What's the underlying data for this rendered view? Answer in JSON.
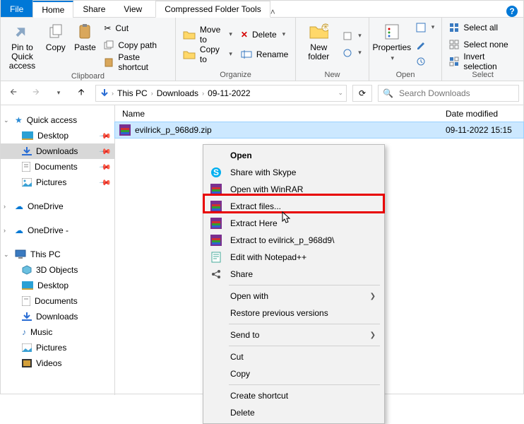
{
  "tabs": {
    "file": "File",
    "home": "Home",
    "share": "Share",
    "view": "View",
    "context": "Compressed Folder Tools"
  },
  "ribbon": {
    "clipboard": {
      "label": "Clipboard",
      "pin": "Pin to Quick access",
      "copy": "Copy",
      "paste": "Paste",
      "cut": "Cut",
      "copy_path": "Copy path",
      "paste_shortcut": "Paste shortcut"
    },
    "organize": {
      "label": "Organize",
      "move_to": "Move to",
      "copy_to": "Copy to",
      "delete": "Delete",
      "rename": "Rename"
    },
    "new": {
      "label": "New",
      "new_folder": "New folder"
    },
    "open": {
      "label": "Open",
      "properties": "Properties"
    },
    "select": {
      "label": "Select",
      "select_all": "Select all",
      "select_none": "Select none",
      "invert": "Invert selection"
    }
  },
  "breadcrumb": {
    "root": "This PC",
    "l1": "Downloads",
    "l2": "09-11-2022"
  },
  "search": {
    "placeholder": "Search Downloads"
  },
  "columns": {
    "name": "Name",
    "date": "Date modified"
  },
  "file": {
    "name": "evilrick_p_968d9.zip",
    "date": "09-11-2022 15:15"
  },
  "sidebar": {
    "quick_access": "Quick access",
    "desktop": "Desktop",
    "downloads": "Downloads",
    "documents": "Documents",
    "pictures": "Pictures",
    "onedrive": "OneDrive",
    "onedrive2": "OneDrive -",
    "this_pc": "This PC",
    "objects3d": "3D Objects",
    "desktop2": "Desktop",
    "documents2": "Documents",
    "downloads2": "Downloads",
    "music": "Music",
    "pictures2": "Pictures",
    "videos": "Videos"
  },
  "context_menu": {
    "open": "Open",
    "share_skype": "Share with Skype",
    "open_winrar": "Open with WinRAR",
    "extract_files": "Extract files...",
    "extract_here": "Extract Here",
    "extract_to": "Extract to evilrick_p_968d9\\",
    "edit_notepad": "Edit with Notepad++",
    "share": "Share",
    "open_with": "Open with",
    "restore": "Restore previous versions",
    "send_to": "Send to",
    "cut": "Cut",
    "copy": "Copy",
    "create_shortcut": "Create shortcut",
    "delete": "Delete"
  }
}
